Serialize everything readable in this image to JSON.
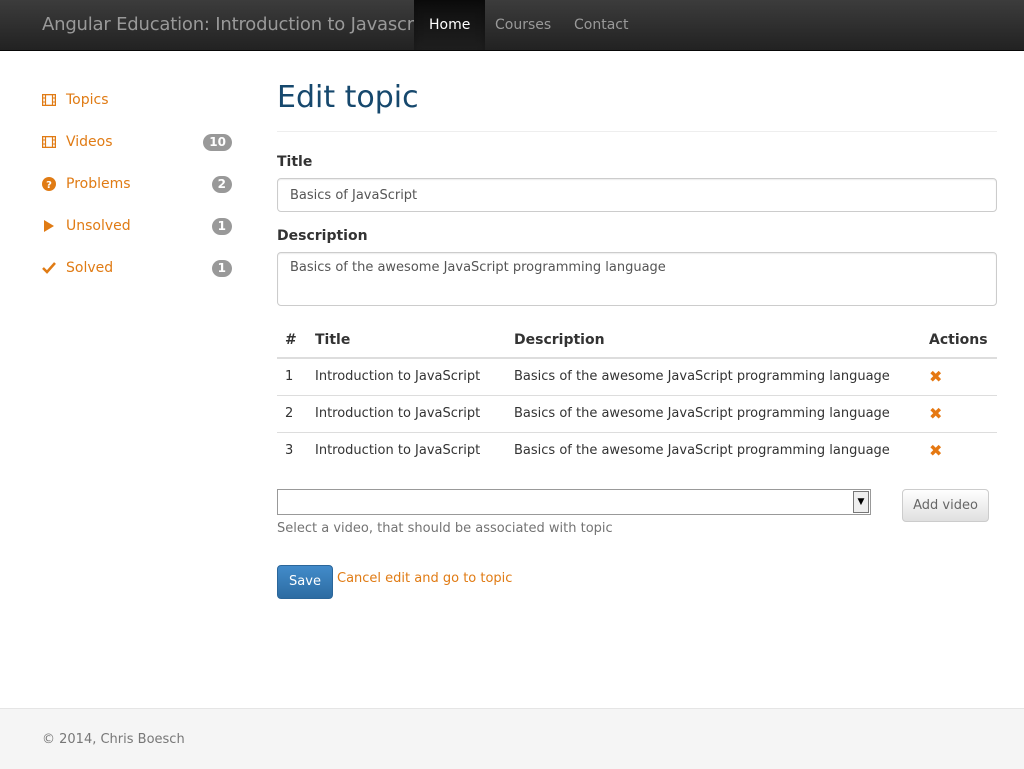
{
  "navbar": {
    "brand": "Angular Education: Introduction to Javascript",
    "links": [
      {
        "label": "Home",
        "active": true
      },
      {
        "label": "Courses",
        "active": false
      },
      {
        "label": "Contact",
        "active": false
      }
    ]
  },
  "sidebar": {
    "items": [
      {
        "label": "Topics",
        "icon": "film-icon",
        "badge": ""
      },
      {
        "label": "Videos",
        "icon": "film-icon",
        "badge": "10"
      },
      {
        "label": "Problems",
        "icon": "question-circle-icon",
        "badge": "2"
      },
      {
        "label": "Unsolved",
        "icon": "play-icon",
        "badge": "1"
      },
      {
        "label": "Solved",
        "icon": "checkmark-icon",
        "badge": "1"
      }
    ]
  },
  "main": {
    "title": "Edit topic",
    "title_field": {
      "label": "Title",
      "value": "Basics of JavaScript"
    },
    "description_field": {
      "label": "Description",
      "value": "Basics of the awesome JavaScript programming language"
    },
    "table": {
      "headers": [
        "#",
        "Title",
        "Description",
        "Actions"
      ],
      "rows": [
        {
          "num": "1",
          "title": "Introduction to JavaScript",
          "description": "Basics of the awesome JavaScript programming language"
        },
        {
          "num": "2",
          "title": "Introduction to JavaScript",
          "description": "Basics of the awesome JavaScript programming language"
        },
        {
          "num": "3",
          "title": "Introduction to JavaScript",
          "description": "Basics of the awesome JavaScript programming language"
        }
      ]
    },
    "video_select": {
      "value": "",
      "help": "Select a video, that should be associated with topic"
    },
    "add_video_label": "Add video",
    "save_label": "Save",
    "cancel_label": "Cancel edit and go to topic"
  },
  "footer": {
    "text": "© 2014, Chris Boesch"
  },
  "colors": {
    "accent": "#e07b14",
    "title": "#16486d",
    "primary": "#428bca",
    "badge": "#999999"
  }
}
